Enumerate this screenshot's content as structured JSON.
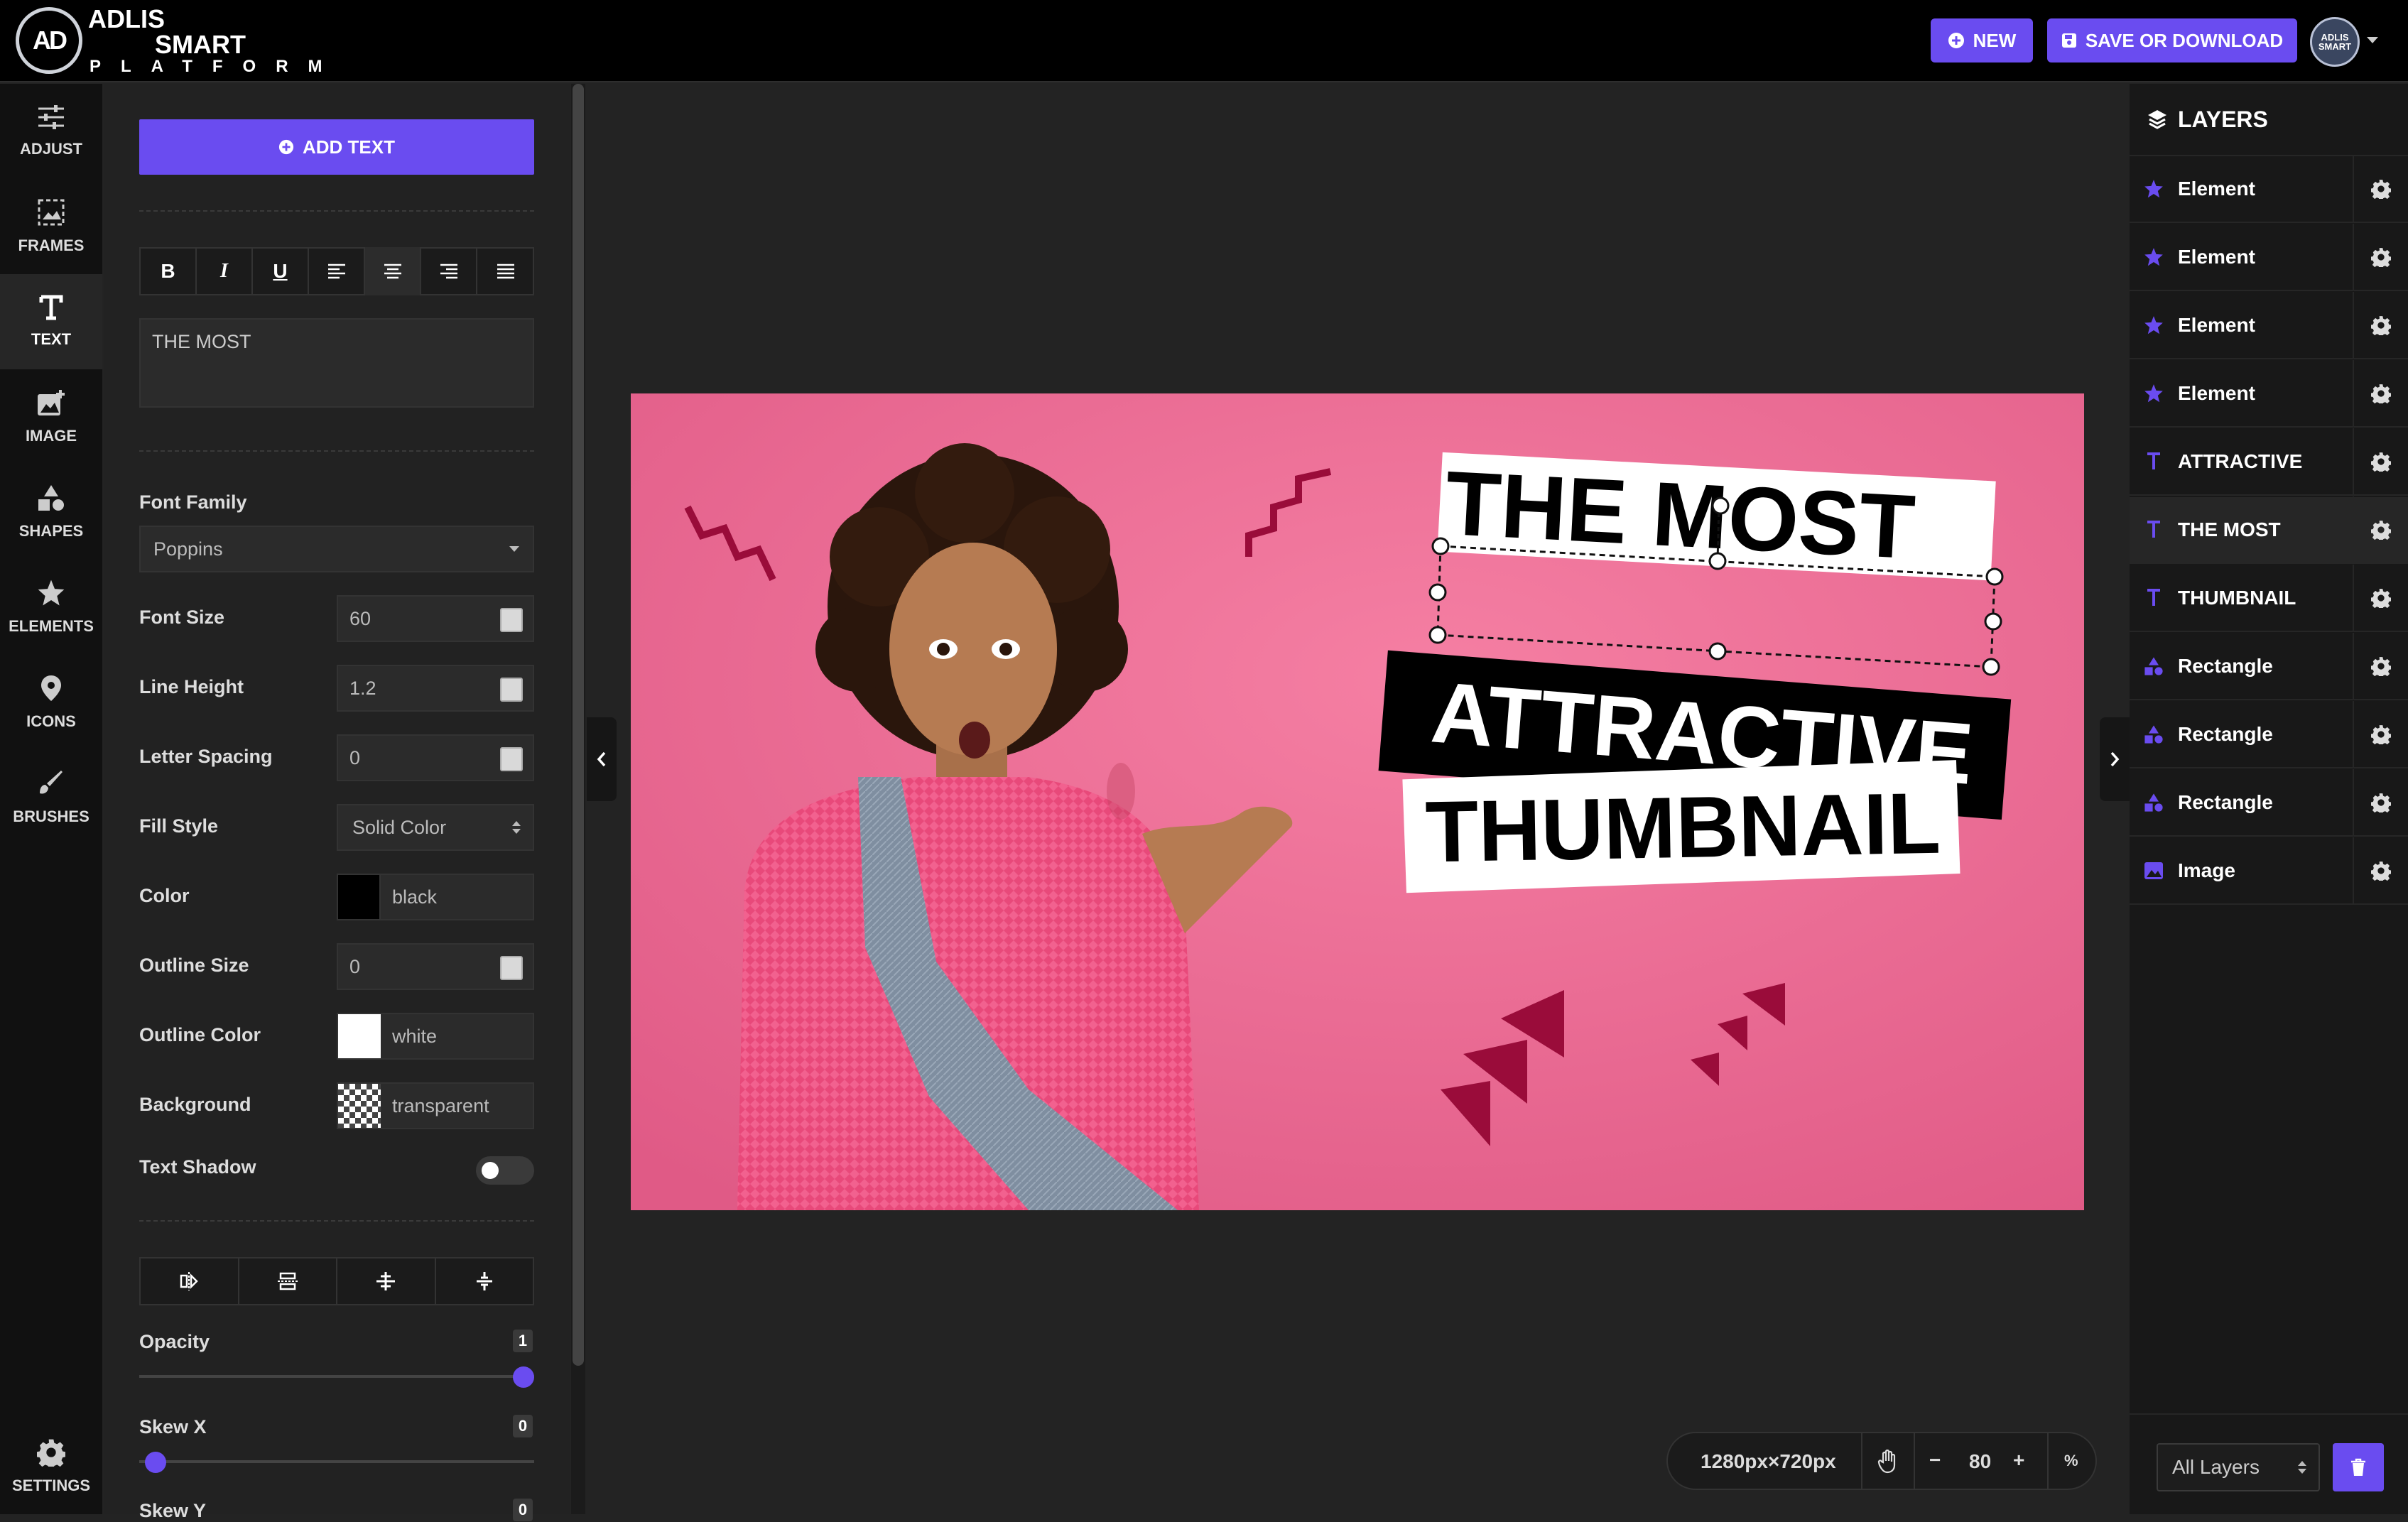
{
  "brand": {
    "line1": "ADLIS",
    "line2": "SMART",
    "line3": "PLATFORM",
    "monogram": "AD",
    "accent": "#6a4cf0"
  },
  "header": {
    "new_label": "NEW",
    "save_label": "SAVE OR DOWNLOAD",
    "avatar_text": "ADLIS SMART"
  },
  "rail": [
    {
      "label": "ADJUST",
      "icon": "sliders-icon"
    },
    {
      "label": "FRAMES",
      "icon": "frame-icon"
    },
    {
      "label": "TEXT",
      "icon": "text-icon"
    },
    {
      "label": "IMAGE",
      "icon": "image-add-icon"
    },
    {
      "label": "SHAPES",
      "icon": "shapes-icon"
    },
    {
      "label": "ELEMENTS",
      "icon": "star-icon"
    },
    {
      "label": "ICONS",
      "icon": "map-pin-icon"
    },
    {
      "label": "BRUSHES",
      "icon": "brush-icon"
    },
    {
      "label": "SETTINGS",
      "icon": "gear-icon"
    }
  ],
  "panel": {
    "add_text_label": "ADD TEXT",
    "format_buttons": [
      "B",
      "I",
      "U"
    ],
    "text_value": "THE MOST",
    "font_family_label": "Font Family",
    "font_family_value": "Poppins",
    "font_size_label": "Font Size",
    "font_size_value": "60",
    "line_height_label": "Line Height",
    "line_height_value": "1.2",
    "letter_spacing_label": "Letter Spacing",
    "letter_spacing_value": "0",
    "fill_style_label": "Fill Style",
    "fill_style_value": "Solid Color",
    "color_label": "Color",
    "color_value": "black",
    "outline_size_label": "Outline Size",
    "outline_size_value": "0",
    "outline_color_label": "Outline Color",
    "outline_color_value": "white",
    "background_label": "Background",
    "background_value": "transparent",
    "text_shadow_label": "Text Shadow",
    "text_shadow_on": false,
    "opacity_label": "Opacity",
    "opacity_value": "1",
    "skew_x_label": "Skew X",
    "skew_x_value": "0",
    "skew_y_label": "Skew Y",
    "skew_y_value": "0"
  },
  "canvas": {
    "line1": "THE MOST",
    "line2": "ATTRACTIVE",
    "line3": "THUMBNAIL",
    "bg_color": "#f0709a",
    "shape_color": "#9a0c3a"
  },
  "zoom": {
    "size_label": "1280px×720px",
    "minus": "−",
    "value": "80",
    "plus": "+",
    "unit": "%"
  },
  "layers": {
    "title": "LAYERS",
    "items": [
      {
        "name": "Element",
        "type": "star"
      },
      {
        "name": "Element",
        "type": "star"
      },
      {
        "name": "Element",
        "type": "star"
      },
      {
        "name": "Element",
        "type": "star"
      },
      {
        "name": "ATTRACTIVE",
        "type": "text"
      },
      {
        "name": "THE MOST",
        "type": "text"
      },
      {
        "name": "THUMBNAIL",
        "type": "text"
      },
      {
        "name": "Rectangle",
        "type": "shapes"
      },
      {
        "name": "Rectangle",
        "type": "shapes"
      },
      {
        "name": "Rectangle",
        "type": "shapes"
      },
      {
        "name": "Image",
        "type": "image"
      }
    ],
    "active_index": 5,
    "filter_value": "All Layers"
  }
}
